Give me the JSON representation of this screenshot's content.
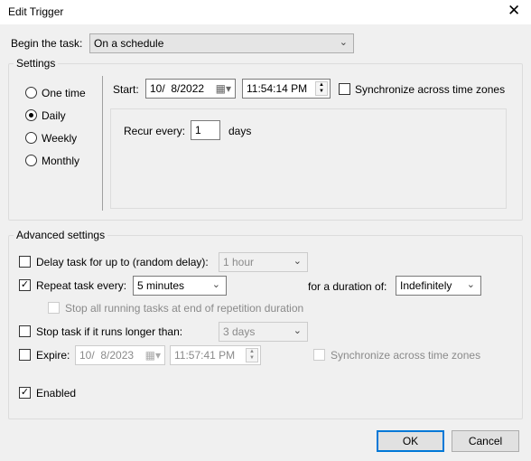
{
  "window": {
    "title": "Edit Trigger",
    "close_icon": "close-icon"
  },
  "begin": {
    "label": "Begin the task:",
    "value": "On a schedule"
  },
  "settings": {
    "legend": "Settings",
    "radios": [
      {
        "label": "One time",
        "checked": false
      },
      {
        "label": "Daily",
        "checked": true
      },
      {
        "label": "Weekly",
        "checked": false
      },
      {
        "label": "Monthly",
        "checked": false
      }
    ],
    "start_label": "Start:",
    "start_date": "10/  8/2022",
    "start_time": "11:54:14 PM",
    "sync_label": "Synchronize across time zones",
    "sync_checked": false,
    "recur_label": "Recur every:",
    "recur_value": "1",
    "recur_unit": "days"
  },
  "advanced": {
    "legend": "Advanced settings",
    "delay": {
      "label": "Delay task for up to (random delay):",
      "checked": false,
      "value": "1 hour"
    },
    "repeat": {
      "label": "Repeat task every:",
      "checked": true,
      "value": "5 minutes",
      "duration_label": "for a duration of:",
      "duration_value": "Indefinitely"
    },
    "stop_all": {
      "label": "Stop all running tasks at end of repetition duration",
      "checked": false
    },
    "stop_task": {
      "label": "Stop task if it runs longer than:",
      "checked": false,
      "value": "3 days"
    },
    "expire": {
      "label": "Expire:",
      "checked": false,
      "date": "10/  8/2023",
      "time": "11:57:41 PM",
      "sync_label": "Synchronize across time zones"
    },
    "enabled": {
      "label": "Enabled",
      "checked": true
    }
  },
  "buttons": {
    "ok": "OK",
    "cancel": "Cancel"
  }
}
